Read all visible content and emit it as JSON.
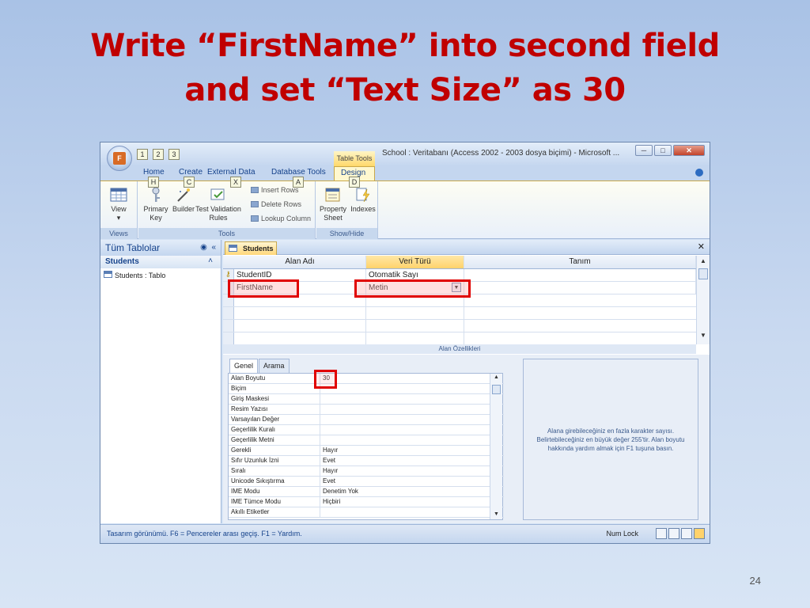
{
  "slide": {
    "title_line1": "Write “FirstName” into second field",
    "title_line2": "and set “Text Size” as 30",
    "page_number": "24"
  },
  "window": {
    "title": "School : Veritabanı (Access 2002 - 2003 dosya biçimi) - Microsoft ...",
    "contextual_group": "Table Tools",
    "office_button_keytip": "F",
    "qat_keytips": [
      "1",
      "2",
      "3"
    ],
    "controls": {
      "minimize": "─",
      "maximize": "□",
      "close": "✕"
    }
  },
  "ribbon_tabs": [
    {
      "label": "Home",
      "keytip": "H"
    },
    {
      "label": "Create",
      "keytip": "C"
    },
    {
      "label": "External Data",
      "keytip": "X"
    },
    {
      "label": "Database Tools",
      "keytip": "A"
    },
    {
      "label": "Design",
      "keytip": "D"
    }
  ],
  "ribbon": {
    "views_group": {
      "label": "Views",
      "view_button": "View"
    },
    "tools_group": {
      "label": "Tools",
      "primary_key": "Primary Key",
      "builder": "Builder",
      "test_validation": "Test Validation Rules",
      "insert_rows": "Insert Rows",
      "delete_rows": "Delete Rows",
      "lookup_column": "Lookup Column"
    },
    "showhide_group": {
      "label": "Show/Hide",
      "property_sheet": "Property Sheet",
      "indexes": "Indexes"
    }
  },
  "nav_pane": {
    "header": "Tüm Tablolar",
    "group": "Students",
    "items": [
      {
        "label": "Students : Tablo"
      }
    ]
  },
  "document": {
    "tab": "Students",
    "columns": [
      "Alan Adı",
      "Veri Türü",
      "Tanım"
    ],
    "fields": [
      {
        "name": "StudentID",
        "type": "Otomatik Sayı",
        "description": ""
      },
      {
        "name": "FirstName",
        "type": "Metin",
        "description": ""
      }
    ],
    "properties_label": "Alan Özellikleri"
  },
  "properties": {
    "tabs": [
      "Genel",
      "Arama"
    ],
    "rows": [
      {
        "label": "Alan Boyutu",
        "value": "30"
      },
      {
        "label": "Biçim",
        "value": ""
      },
      {
        "label": "Giriş Maskesi",
        "value": ""
      },
      {
        "label": "Resim Yazısı",
        "value": ""
      },
      {
        "label": "Varsayılan Değer",
        "value": ""
      },
      {
        "label": "Geçerlilik Kuralı",
        "value": ""
      },
      {
        "label": "Geçerlilik Metni",
        "value": ""
      },
      {
        "label": "Gerekli",
        "value": "Hayır"
      },
      {
        "label": "Sıfır Uzunluk İzni",
        "value": "Evet"
      },
      {
        "label": "Sıralı",
        "value": "Hayır"
      },
      {
        "label": "Unicode Sıkıştırma",
        "value": "Evet"
      },
      {
        "label": "IME Modu",
        "value": "Denetim Yok"
      },
      {
        "label": "IME Tümce Modu",
        "value": "Hiçbiri"
      },
      {
        "label": "Akıllı Etiketler",
        "value": ""
      }
    ],
    "help_text": "Alana girebileceğiniz en fazla karakter sayısı. Belirtebileceğiniz en büyük değer 255'tir. Alan boyutu hakkında yardım almak için F1 tuşuna basın."
  },
  "statusbar": {
    "text": "Tasarım görünümü.  F6 = Pencereler arası geçiş.  F1 = Yardım.",
    "num_lock": "Num Lock"
  },
  "colors": {
    "title_red": "#c00000",
    "highlight_red": "#e00000",
    "ribbon_accent": "#ffd26b"
  }
}
